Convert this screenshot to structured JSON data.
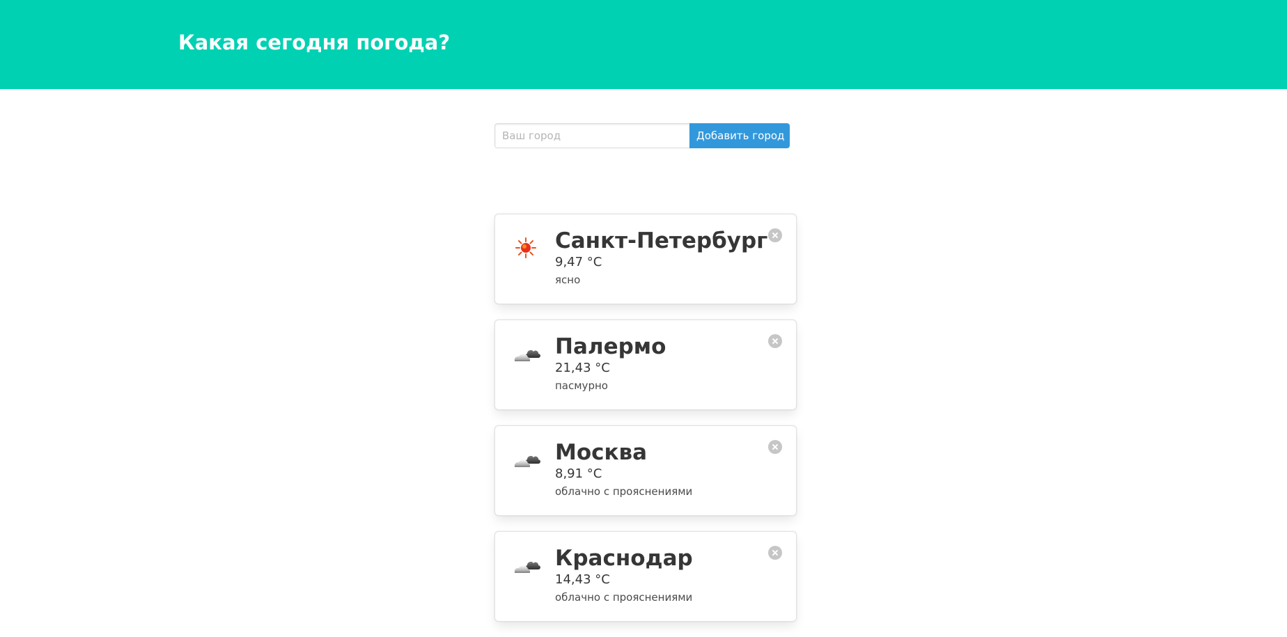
{
  "header": {
    "title": "Какая сегодня погода?",
    "background_color": "#00d1b2"
  },
  "add_form": {
    "input_placeholder": "Ваш город",
    "input_value": "",
    "button_label": "Добавить город",
    "button_color": "#3298dc"
  },
  "cities": [
    {
      "name": "Санкт-Петербург",
      "temperature": "9,47 °C",
      "description": "ясно",
      "icon": "sun-icon"
    },
    {
      "name": "Палермо",
      "temperature": "21,43 °C",
      "description": "пасмурно",
      "icon": "cloudy-icon"
    },
    {
      "name": "Москва",
      "temperature": "8,91 °C",
      "description": "облачно с прояснениями",
      "icon": "partly-cloudy-icon"
    },
    {
      "name": "Краснодар",
      "temperature": "14,43 °C",
      "description": "облачно с прояснениями",
      "icon": "partly-cloudy-icon"
    }
  ]
}
